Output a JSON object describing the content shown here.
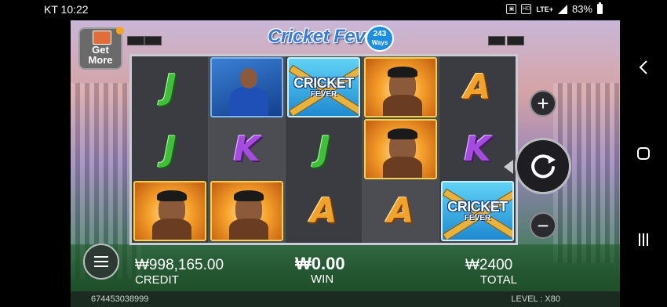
{
  "status_bar": {
    "carrier_time": "KT 10:22",
    "network": "LTE+",
    "battery": "83%",
    "hd_icon": "HD",
    "icons": [
      "sim-icon",
      "hd-icon",
      "signal-icon",
      "battery-icon"
    ]
  },
  "game": {
    "title": "Cricket Fever",
    "ways_number": "243",
    "ways_label": "Ways",
    "get_more": "Get More",
    "scatter_text_1": "CRICKET",
    "scatter_text_2": "FEVER",
    "reels": [
      [
        "J",
        "J",
        "player"
      ],
      [
        "batter",
        "K",
        "player"
      ],
      [
        "scatter",
        "J",
        "A"
      ],
      [
        "player",
        "player",
        "A"
      ],
      [
        "A",
        "K",
        "scatter"
      ]
    ],
    "meters": {
      "credit_value": "₩998,165.00",
      "credit_label": "CREDIT",
      "win_value": "₩0.00",
      "win_label": "WIN",
      "total_value": "₩2400",
      "total_label": "TOTAL"
    },
    "footer": {
      "session_id": "674453038999",
      "level": "LEVEL : X80"
    },
    "controls": {
      "plus": "+",
      "minus": "−"
    }
  },
  "nav_bar": {
    "icons": [
      "back-icon",
      "home-icon",
      "recents-icon"
    ]
  }
}
